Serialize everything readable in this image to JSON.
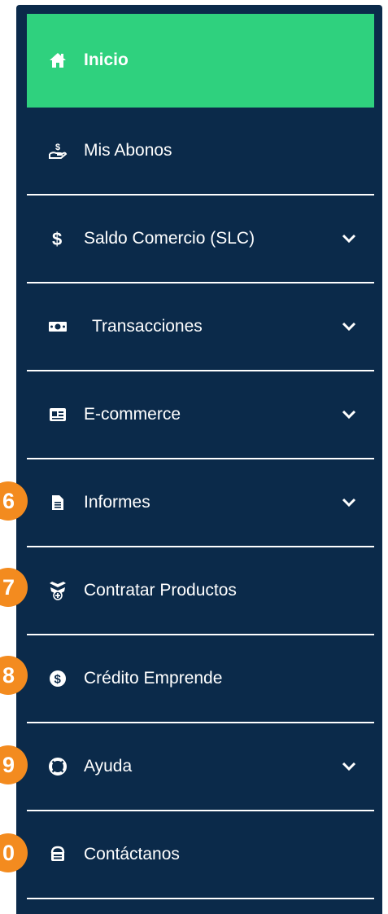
{
  "menu": {
    "items": [
      {
        "label": "Inicio",
        "icon": "home-icon",
        "active": true,
        "expandable": false,
        "badge": ""
      },
      {
        "label": "Mis Abonos",
        "icon": "hand-money-icon",
        "active": false,
        "expandable": false,
        "badge": ""
      },
      {
        "label": "Saldo Comercio (SLC)",
        "icon": "dollar-icon",
        "active": false,
        "expandable": true,
        "badge": ""
      },
      {
        "label": "Transacciones",
        "icon": "money-bill-icon",
        "active": false,
        "expandable": true,
        "badge": ""
      },
      {
        "label": "E-commerce",
        "icon": "id-card-icon",
        "active": false,
        "expandable": true,
        "badge": ""
      },
      {
        "label": "Informes",
        "icon": "document-icon",
        "active": false,
        "expandable": true,
        "badge": "6"
      },
      {
        "label": "Contratar Productos",
        "icon": "gift-plus-icon",
        "active": false,
        "expandable": false,
        "badge": "7"
      },
      {
        "label": "Crédito Emprende",
        "icon": "dollar-circle-icon",
        "active": false,
        "expandable": false,
        "badge": "8"
      },
      {
        "label": "Ayuda",
        "icon": "lifebuoy-icon",
        "active": false,
        "expandable": true,
        "badge": "9"
      },
      {
        "label": "Contáctanos",
        "icon": "contact-icon",
        "active": false,
        "expandable": false,
        "badge": "0"
      }
    ]
  },
  "colors": {
    "sidebar_bg": "#0b2a4a",
    "active_bg": "#2fd17e",
    "badge": "#f38b1f",
    "text": "#ffffff"
  }
}
